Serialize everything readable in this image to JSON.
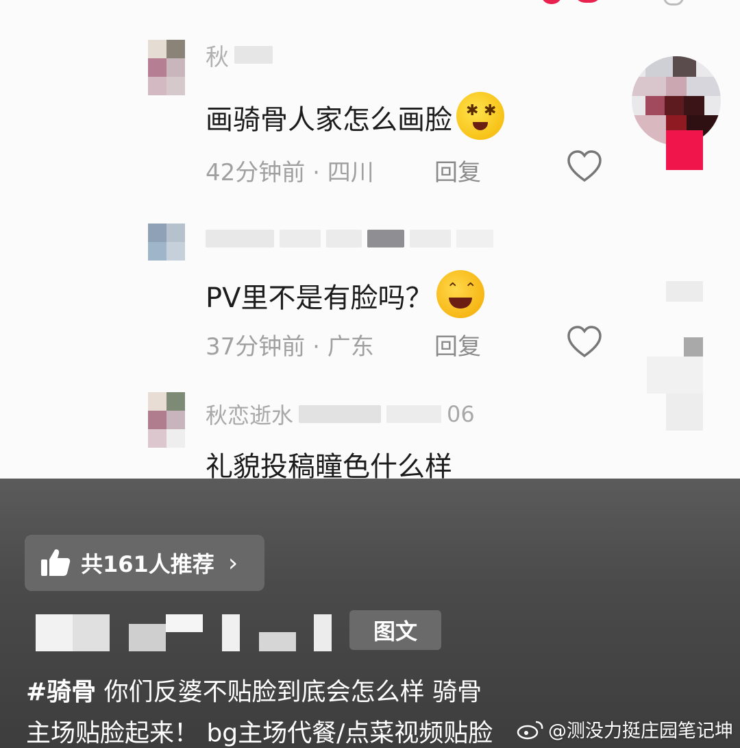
{
  "comments": [
    {
      "name": "秋恋逝水",
      "text": "画骑骨人家怎么画脸",
      "time": "42分钟前",
      "location": "四川",
      "reply_label": "回复",
      "emoji": "dizzy-face"
    },
    {
      "text": "PV里不是有脸吗？",
      "time": "37分钟前",
      "location": "广东",
      "reply_label": "回复",
      "emoji": "tears-of-joy"
    },
    {
      "name": "秋恋逝水",
      "name_suffix": "06",
      "text": "礼貌投稿瞳色什么样"
    }
  ],
  "recommend": {
    "label": "共161人推荐",
    "icon": "thumbs-up-icon"
  },
  "post": {
    "tag_label": "图文",
    "hashtag": "#骑骨",
    "caption_line1": "你们反婆不贴脸到底会怎么样 骑骨",
    "caption_line2": "主场贴脸起来！ bg主场代餐/点菜视频贴脸"
  },
  "watermark": {
    "text": "@测没力挺庄园笔记坤",
    "icon": "weibo-icon"
  },
  "colors": {
    "like_red": "#f0154a",
    "overlay_bg": "#4a4a4a",
    "pill_bg": "#686868"
  }
}
